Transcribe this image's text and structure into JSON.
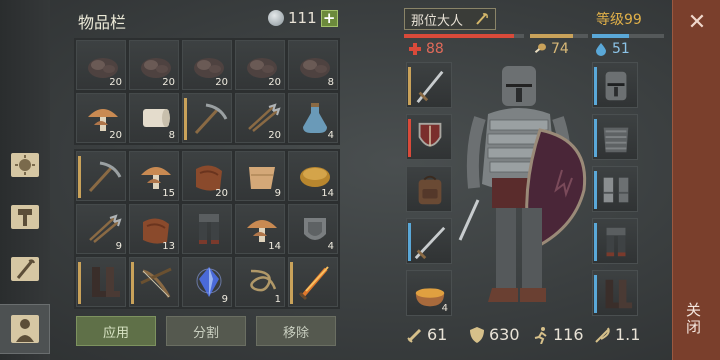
{
  "inventory": {
    "title": "物品栏",
    "coins": "111",
    "plus": "+",
    "top_slots": [
      {
        "icon": "iron-ore-icon",
        "count": "20"
      },
      {
        "icon": "iron-ore-icon",
        "count": "20"
      },
      {
        "icon": "iron-ore-icon",
        "count": "20"
      },
      {
        "icon": "iron-ore-icon",
        "count": "20"
      },
      {
        "icon": "iron-ore-icon",
        "count": "8"
      },
      {
        "icon": "mushroom-icon",
        "count": "20"
      },
      {
        "icon": "bandage-roll-icon",
        "count": "8"
      },
      {
        "icon": "pickaxe-icon",
        "count": ""
      },
      {
        "icon": "crossbow-bolts-icon",
        "count": "20"
      },
      {
        "icon": "flask-icon",
        "count": "4"
      }
    ],
    "bottom_slots": [
      {
        "icon": "pickaxe-icon",
        "count": ""
      },
      {
        "icon": "mushroom-icon",
        "count": "15"
      },
      {
        "icon": "leather-icon",
        "count": "20"
      },
      {
        "icon": "cloth-icon",
        "count": "9"
      },
      {
        "icon": "bread-loaf-icon",
        "count": "14"
      },
      {
        "icon": "crossbow-bolts-icon",
        "count": "9"
      },
      {
        "icon": "leather-icon",
        "count": "13"
      },
      {
        "icon": "leg-armor-icon",
        "count": ""
      },
      {
        "icon": "mushroom-icon",
        "count": "14"
      },
      {
        "icon": "shield-plate-icon",
        "count": "4"
      },
      {
        "icon": "boots-icon",
        "count": ""
      },
      {
        "icon": "crossbow-icon",
        "count": ""
      },
      {
        "icon": "crystal-icon",
        "count": "9"
      },
      {
        "icon": "rope-icon",
        "count": "1"
      },
      {
        "icon": "flame-sword-icon",
        "count": ""
      }
    ],
    "actions": {
      "apply": "应用",
      "split": "分割",
      "move": "移除"
    }
  },
  "character": {
    "name": "那位大人",
    "level": "等级99",
    "health": "88",
    "food": "74",
    "water": "51",
    "health_level": 0.92,
    "food_level": 0.74,
    "water_level": 0.51,
    "left_equipment": [
      {
        "icon": "sword-icon",
        "count": ""
      },
      {
        "icon": "kite-shield-icon",
        "count": ""
      },
      {
        "icon": "backpack-icon",
        "count": ""
      },
      {
        "icon": "longsword-icon",
        "count": ""
      },
      {
        "icon": "soup-bowl-icon",
        "count": "4"
      }
    ],
    "right_equipment": [
      {
        "icon": "great-helm-icon"
      },
      {
        "icon": "chainmail-icon"
      },
      {
        "icon": "gauntlets-icon"
      },
      {
        "icon": "leg-armor-icon"
      },
      {
        "icon": "boots-icon"
      }
    ],
    "stats": {
      "attack": "61",
      "defense": "630",
      "speed": "116",
      "weight": "1.1"
    }
  },
  "close": {
    "label": "关闭",
    "x": "✕"
  },
  "colors": {
    "health": "#d94a3a",
    "food": "#c9a25a",
    "water": "#5aa8d8",
    "level": "#e0b049"
  }
}
